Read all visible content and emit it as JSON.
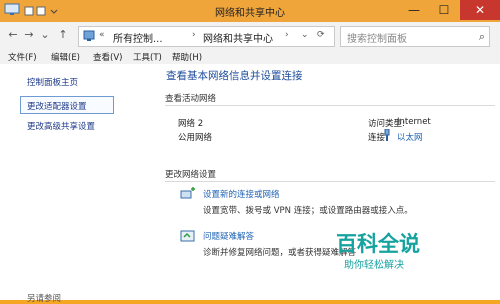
{
  "window": {
    "title": "网络和共享中心",
    "minimize": "—",
    "maximize": "☐",
    "close": "✕"
  },
  "address": {
    "overflow": "«",
    "crumbs": [
      "所有控制...",
      "网络和共享中心"
    ],
    "search_placeholder": "搜索控制面板"
  },
  "menu": [
    "文件(F)",
    "编辑(E)",
    "查看(V)",
    "工具(T)",
    "帮助(H)"
  ],
  "sidebar": {
    "items": [
      "控制面板主页",
      "更改适配器设置",
      "更改高级共享设置"
    ],
    "footer": "另请参阅"
  },
  "main": {
    "heading": "查看基本网络信息并设置连接",
    "active_title": "查看活动网络",
    "network_name": "网络  2",
    "network_type": "公用网络",
    "access_label": "访问类型:",
    "access_value": "Internet",
    "conn_label": "连接:",
    "conn_value": "以太网",
    "change_title": "更改网络设置",
    "item1_link": "设置新的连接或网络",
    "item1_desc": "设置宽带、拨号或 VPN 连接；或设置路由器或接入点。",
    "item2_link": "问题疑难解答",
    "item2_desc": "诊断并修复网络问题，或者获得疑难解答"
  },
  "watermark": {
    "main": "百科全说",
    "sub": "助你轻松解决"
  }
}
